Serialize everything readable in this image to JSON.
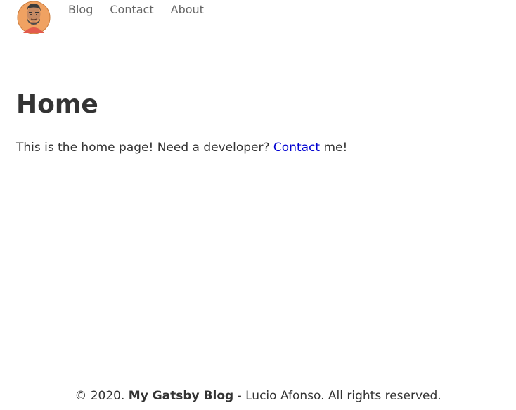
{
  "nav": {
    "avatar_icon": "avatar-icon",
    "items": [
      {
        "label": "Blog"
      },
      {
        "label": "Contact"
      },
      {
        "label": "About"
      }
    ]
  },
  "main": {
    "title": "Home",
    "intro_before": "This is the home page! Need a developer? ",
    "intro_link": "Contact",
    "intro_after": " me!"
  },
  "footer": {
    "copyright": "© 2020. ",
    "site_name": "My Gatsby Blog",
    "rest": " - Lucio Afonso. All rights reserved."
  },
  "colors": {
    "text": "#333333",
    "nav_text": "#666666",
    "link": "#0000d0",
    "avatar_bg": "#f0a262"
  }
}
